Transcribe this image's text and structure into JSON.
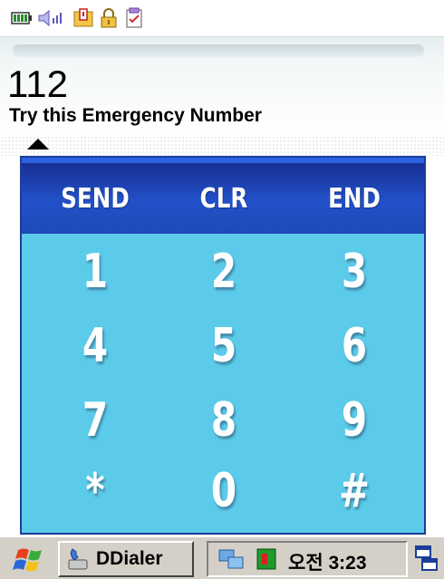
{
  "status_bar": {
    "icons": [
      "battery-icon",
      "volume-icon",
      "notification-icon",
      "lock-icon",
      "tasks-icon"
    ]
  },
  "display": {
    "number": "112",
    "hint": "Try this Emergency Number"
  },
  "keypad": {
    "function_keys": [
      {
        "label": "SEND",
        "action": "send"
      },
      {
        "label": "CLR",
        "action": "clear"
      },
      {
        "label": "END",
        "action": "end"
      }
    ],
    "keys": [
      [
        "1",
        "2",
        "3"
      ],
      [
        "4",
        "5",
        "6"
      ],
      [
        "7",
        "8",
        "9"
      ],
      [
        "*",
        "0",
        "#"
      ]
    ]
  },
  "taskbar": {
    "start_icon": "windows-flag-icon",
    "active_app": "DDialer",
    "tray_icons": [
      "network-icon",
      "green-app-icon"
    ],
    "clock": "오전 3:23",
    "switch_icon": "window-switch-icon"
  },
  "colors": {
    "keypad_bg": "#5ccbea",
    "header_bg": "#2250c8",
    "key_text": "#ffffff",
    "taskbar_bg": "#d4d0c8"
  }
}
